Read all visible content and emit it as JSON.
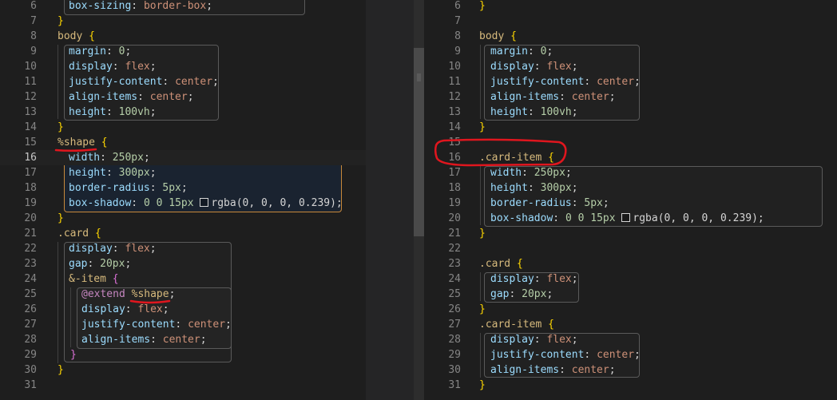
{
  "left": {
    "lines": [
      {
        "n": "6",
        "parts": [
          [
            "prop",
            "box-sizing"
          ],
          [
            "punc",
            ": "
          ],
          [
            "val",
            "border-box"
          ],
          [
            "punc",
            ";"
          ]
        ]
      },
      {
        "n": "7",
        "parts": [
          [
            "brace",
            "}"
          ]
        ]
      },
      {
        "n": "8",
        "parts": [
          [
            "sel",
            "body"
          ],
          [
            "punc",
            " "
          ],
          [
            "brace",
            "{"
          ]
        ]
      },
      {
        "n": "9",
        "parts": [
          [
            "prop",
            "margin"
          ],
          [
            "punc",
            ": "
          ],
          [
            "num",
            "0"
          ],
          [
            "punc",
            ";"
          ]
        ]
      },
      {
        "n": "10",
        "parts": [
          [
            "prop",
            "display"
          ],
          [
            "punc",
            ": "
          ],
          [
            "val",
            "flex"
          ],
          [
            "punc",
            ";"
          ]
        ]
      },
      {
        "n": "11",
        "parts": [
          [
            "prop",
            "justify-content"
          ],
          [
            "punc",
            ": "
          ],
          [
            "val",
            "center"
          ],
          [
            "punc",
            ";"
          ]
        ]
      },
      {
        "n": "12",
        "parts": [
          [
            "prop",
            "align-items"
          ],
          [
            "punc",
            ": "
          ],
          [
            "val",
            "center"
          ],
          [
            "punc",
            ";"
          ]
        ]
      },
      {
        "n": "13",
        "parts": [
          [
            "prop",
            "height"
          ],
          [
            "punc",
            ": "
          ],
          [
            "num",
            "100vh"
          ],
          [
            "punc",
            ";"
          ]
        ]
      },
      {
        "n": "14",
        "parts": [
          [
            "brace",
            "}"
          ]
        ]
      },
      {
        "n": "15",
        "parts": [
          [
            "sel",
            "%shape"
          ],
          [
            "punc",
            " "
          ],
          [
            "brace",
            "{"
          ]
        ]
      },
      {
        "n": "16",
        "parts": [
          [
            "prop",
            "width"
          ],
          [
            "punc",
            ": "
          ],
          [
            "num",
            "250px"
          ],
          [
            "punc",
            ";"
          ]
        ]
      },
      {
        "n": "17",
        "parts": [
          [
            "prop",
            "height"
          ],
          [
            "punc",
            ": "
          ],
          [
            "num",
            "300px"
          ],
          [
            "punc",
            ";"
          ]
        ]
      },
      {
        "n": "18",
        "parts": [
          [
            "prop",
            "border-radius"
          ],
          [
            "punc",
            ": "
          ],
          [
            "num",
            "5px"
          ],
          [
            "punc",
            ";"
          ]
        ]
      },
      {
        "n": "19",
        "parts": [
          [
            "prop",
            "box-shadow"
          ],
          [
            "punc",
            ": "
          ],
          [
            "num",
            "0 0 15px "
          ],
          [
            "swatch",
            ""
          ],
          [
            "punc",
            "rgba(0, 0, 0, 0.239);"
          ]
        ]
      },
      {
        "n": "20",
        "parts": [
          [
            "brace",
            "}"
          ]
        ]
      },
      {
        "n": "21",
        "parts": [
          [
            "sel",
            ".card"
          ],
          [
            "punc",
            " "
          ],
          [
            "brace",
            "{"
          ]
        ]
      },
      {
        "n": "22",
        "parts": [
          [
            "prop",
            "display"
          ],
          [
            "punc",
            ": "
          ],
          [
            "val",
            "flex"
          ],
          [
            "punc",
            ";"
          ]
        ]
      },
      {
        "n": "23",
        "parts": [
          [
            "prop",
            "gap"
          ],
          [
            "punc",
            ": "
          ],
          [
            "num",
            "20px"
          ],
          [
            "punc",
            ";"
          ]
        ]
      },
      {
        "n": "24",
        "parts": [
          [
            "amp",
            "&-item"
          ],
          [
            "punc",
            " "
          ],
          [
            "brace2",
            "{"
          ]
        ]
      },
      {
        "n": "25",
        "parts": [
          [
            "kw",
            "@extend"
          ],
          [
            "punc",
            " "
          ],
          [
            "sel",
            "%shape"
          ],
          [
            "punc",
            ";"
          ]
        ]
      },
      {
        "n": "26",
        "parts": [
          [
            "prop",
            "display"
          ],
          [
            "punc",
            ": "
          ],
          [
            "val",
            "flex"
          ],
          [
            "punc",
            ";"
          ]
        ]
      },
      {
        "n": "27",
        "parts": [
          [
            "prop",
            "justify-content"
          ],
          [
            "punc",
            ": "
          ],
          [
            "val",
            "center"
          ],
          [
            "punc",
            ";"
          ]
        ]
      },
      {
        "n": "28",
        "parts": [
          [
            "prop",
            "align-items"
          ],
          [
            "punc",
            ": "
          ],
          [
            "val",
            "center"
          ],
          [
            "punc",
            ";"
          ]
        ]
      },
      {
        "n": "29",
        "parts": [
          [
            "brace2",
            "}"
          ]
        ]
      },
      {
        "n": "30",
        "parts": [
          [
            "brace",
            "}"
          ]
        ]
      },
      {
        "n": "31",
        "parts": []
      }
    ],
    "active_line": "16"
  },
  "right": {
    "lines": [
      {
        "n": "6",
        "parts": [
          [
            "brace",
            "}"
          ]
        ]
      },
      {
        "n": "7",
        "parts": []
      },
      {
        "n": "8",
        "parts": [
          [
            "sel",
            "body"
          ],
          [
            "punc",
            " "
          ],
          [
            "brace",
            "{"
          ]
        ]
      },
      {
        "n": "9",
        "parts": [
          [
            "prop",
            "margin"
          ],
          [
            "punc",
            ": "
          ],
          [
            "num",
            "0"
          ],
          [
            "punc",
            ";"
          ]
        ]
      },
      {
        "n": "10",
        "parts": [
          [
            "prop",
            "display"
          ],
          [
            "punc",
            ": "
          ],
          [
            "val",
            "flex"
          ],
          [
            "punc",
            ";"
          ]
        ]
      },
      {
        "n": "11",
        "parts": [
          [
            "prop",
            "justify-content"
          ],
          [
            "punc",
            ": "
          ],
          [
            "val",
            "center"
          ],
          [
            "punc",
            ";"
          ]
        ]
      },
      {
        "n": "12",
        "parts": [
          [
            "prop",
            "align-items"
          ],
          [
            "punc",
            ": "
          ],
          [
            "val",
            "center"
          ],
          [
            "punc",
            ";"
          ]
        ]
      },
      {
        "n": "13",
        "parts": [
          [
            "prop",
            "height"
          ],
          [
            "punc",
            ": "
          ],
          [
            "num",
            "100vh"
          ],
          [
            "punc",
            ";"
          ]
        ]
      },
      {
        "n": "14",
        "parts": [
          [
            "brace",
            "}"
          ]
        ]
      },
      {
        "n": "15",
        "parts": []
      },
      {
        "n": "16",
        "parts": [
          [
            "sel",
            ".card-item"
          ],
          [
            "punc",
            " "
          ],
          [
            "brace",
            "{"
          ]
        ]
      },
      {
        "n": "17",
        "parts": [
          [
            "prop",
            "width"
          ],
          [
            "punc",
            ": "
          ],
          [
            "num",
            "250px"
          ],
          [
            "punc",
            ";"
          ]
        ]
      },
      {
        "n": "18",
        "parts": [
          [
            "prop",
            "height"
          ],
          [
            "punc",
            ": "
          ],
          [
            "num",
            "300px"
          ],
          [
            "punc",
            ";"
          ]
        ]
      },
      {
        "n": "19",
        "parts": [
          [
            "prop",
            "border-radius"
          ],
          [
            "punc",
            ": "
          ],
          [
            "num",
            "5px"
          ],
          [
            "punc",
            ";"
          ]
        ]
      },
      {
        "n": "20",
        "parts": [
          [
            "prop",
            "box-shadow"
          ],
          [
            "punc",
            ": "
          ],
          [
            "num",
            "0 0 15px "
          ],
          [
            "swatch",
            ""
          ],
          [
            "punc",
            "rgba(0, 0, 0, 0.239);"
          ]
        ]
      },
      {
        "n": "21",
        "parts": [
          [
            "brace",
            "}"
          ]
        ]
      },
      {
        "n": "22",
        "parts": []
      },
      {
        "n": "23",
        "parts": [
          [
            "sel",
            ".card"
          ],
          [
            "punc",
            " "
          ],
          [
            "brace",
            "{"
          ]
        ]
      },
      {
        "n": "24",
        "parts": [
          [
            "prop",
            "display"
          ],
          [
            "punc",
            ": "
          ],
          [
            "val",
            "flex"
          ],
          [
            "punc",
            ";"
          ]
        ]
      },
      {
        "n": "25",
        "parts": [
          [
            "prop",
            "gap"
          ],
          [
            "punc",
            ": "
          ],
          [
            "num",
            "20px"
          ],
          [
            "punc",
            ";"
          ]
        ]
      },
      {
        "n": "26",
        "parts": [
          [
            "brace",
            "}"
          ]
        ]
      },
      {
        "n": "27",
        "parts": [
          [
            "sel",
            ".card-item"
          ],
          [
            "punc",
            " "
          ],
          [
            "brace",
            "{"
          ]
        ]
      },
      {
        "n": "28",
        "parts": [
          [
            "prop",
            "display"
          ],
          [
            "punc",
            ": "
          ],
          [
            "val",
            "flex"
          ],
          [
            "punc",
            ";"
          ]
        ]
      },
      {
        "n": "29",
        "parts": [
          [
            "prop",
            "justify-content"
          ],
          [
            "punc",
            ": "
          ],
          [
            "val",
            "center"
          ],
          [
            "punc",
            ";"
          ]
        ]
      },
      {
        "n": "30",
        "parts": [
          [
            "prop",
            "align-items"
          ],
          [
            "punc",
            ": "
          ],
          [
            "val",
            "center"
          ],
          [
            "punc",
            ";"
          ]
        ]
      },
      {
        "n": "31",
        "parts": [
          [
            "brace",
            "}"
          ]
        ]
      }
    ]
  },
  "colors": {
    "selector": "#d7ba7d",
    "property": "#9cdcfe",
    "number": "#b5cea8",
    "string_value": "#ce9178",
    "keyword": "#c586c0",
    "bracket_gold": "#ffd700",
    "bracket_purple": "#da70d6",
    "annotation_red": "#e0161e"
  }
}
